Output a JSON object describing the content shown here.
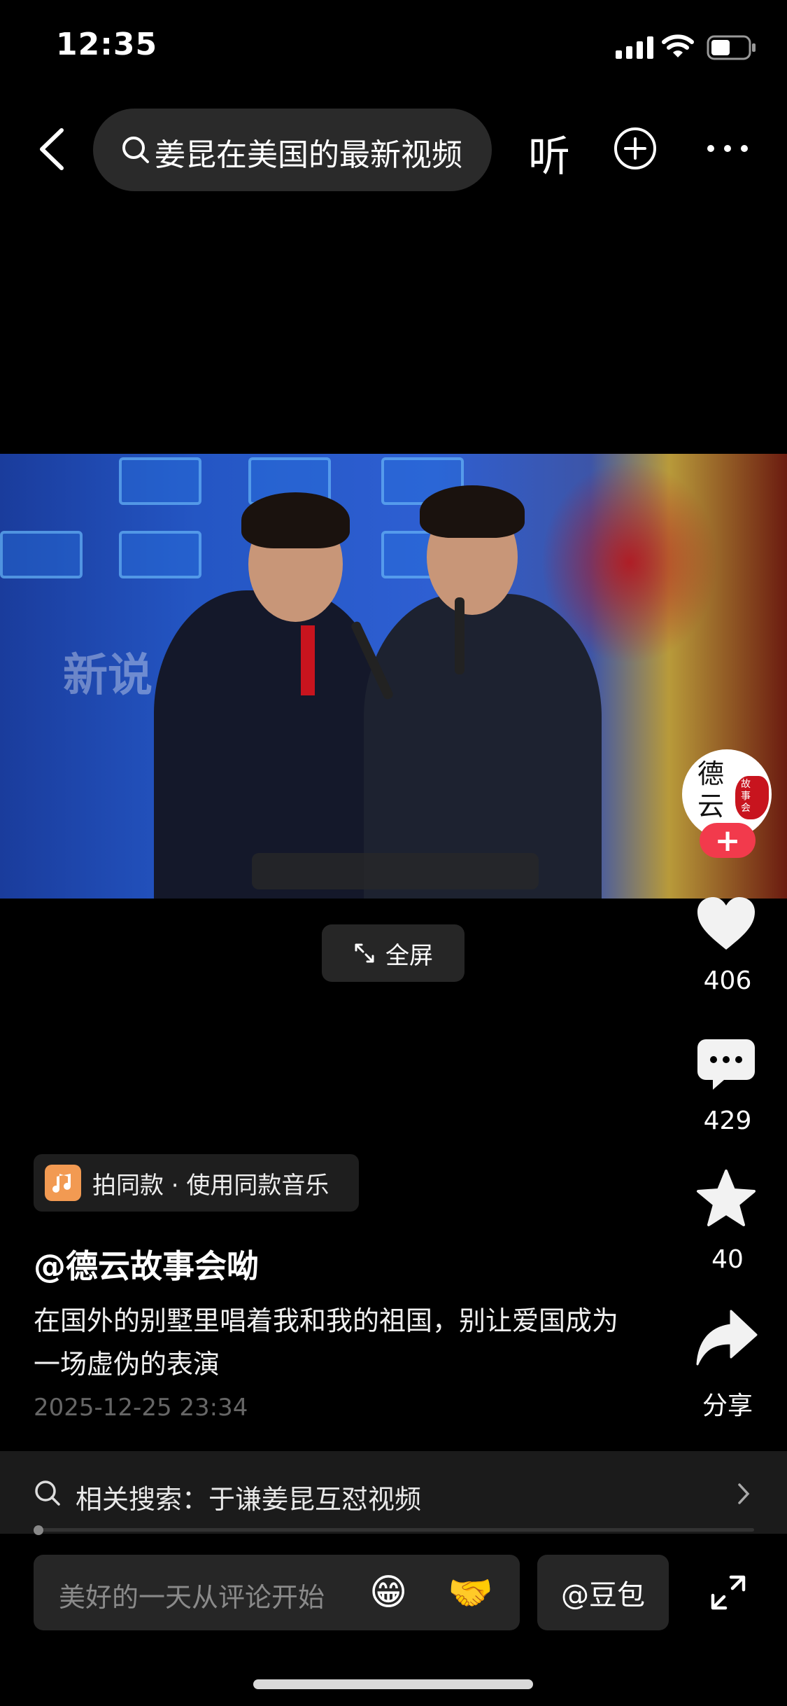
{
  "status_bar": {
    "time": "12:35"
  },
  "top_nav": {
    "search_text": "姜昆在美国的最新视频",
    "listen_label": "听"
  },
  "video": {
    "watermark": "新说",
    "fullscreen_label": "全屏"
  },
  "right_rail": {
    "avatar_text": "德云",
    "avatar_sub": "故事会",
    "like_count": "406",
    "comment_count": "429",
    "favorite_count": "40",
    "share_label": "分享"
  },
  "content": {
    "music_label": "拍同款 · 使用同款音乐",
    "author": "@德云故事会呦",
    "description": "在国外的别墅里唱着我和我的祖国，别让爱国成为一场虚伪的表演",
    "date": "2025-12-25 23:34",
    "related_search": "相关搜索：于谦姜昆互怼视频"
  },
  "bottom_bar": {
    "comment_placeholder": "美好的一天从评论开始",
    "emoji_1": "😁",
    "emoji_2": "🤝",
    "doubao_label": "@豆包"
  },
  "colors": {
    "accent": "#f23a4c",
    "background": "#000000",
    "music_icon": "#f29a52"
  }
}
